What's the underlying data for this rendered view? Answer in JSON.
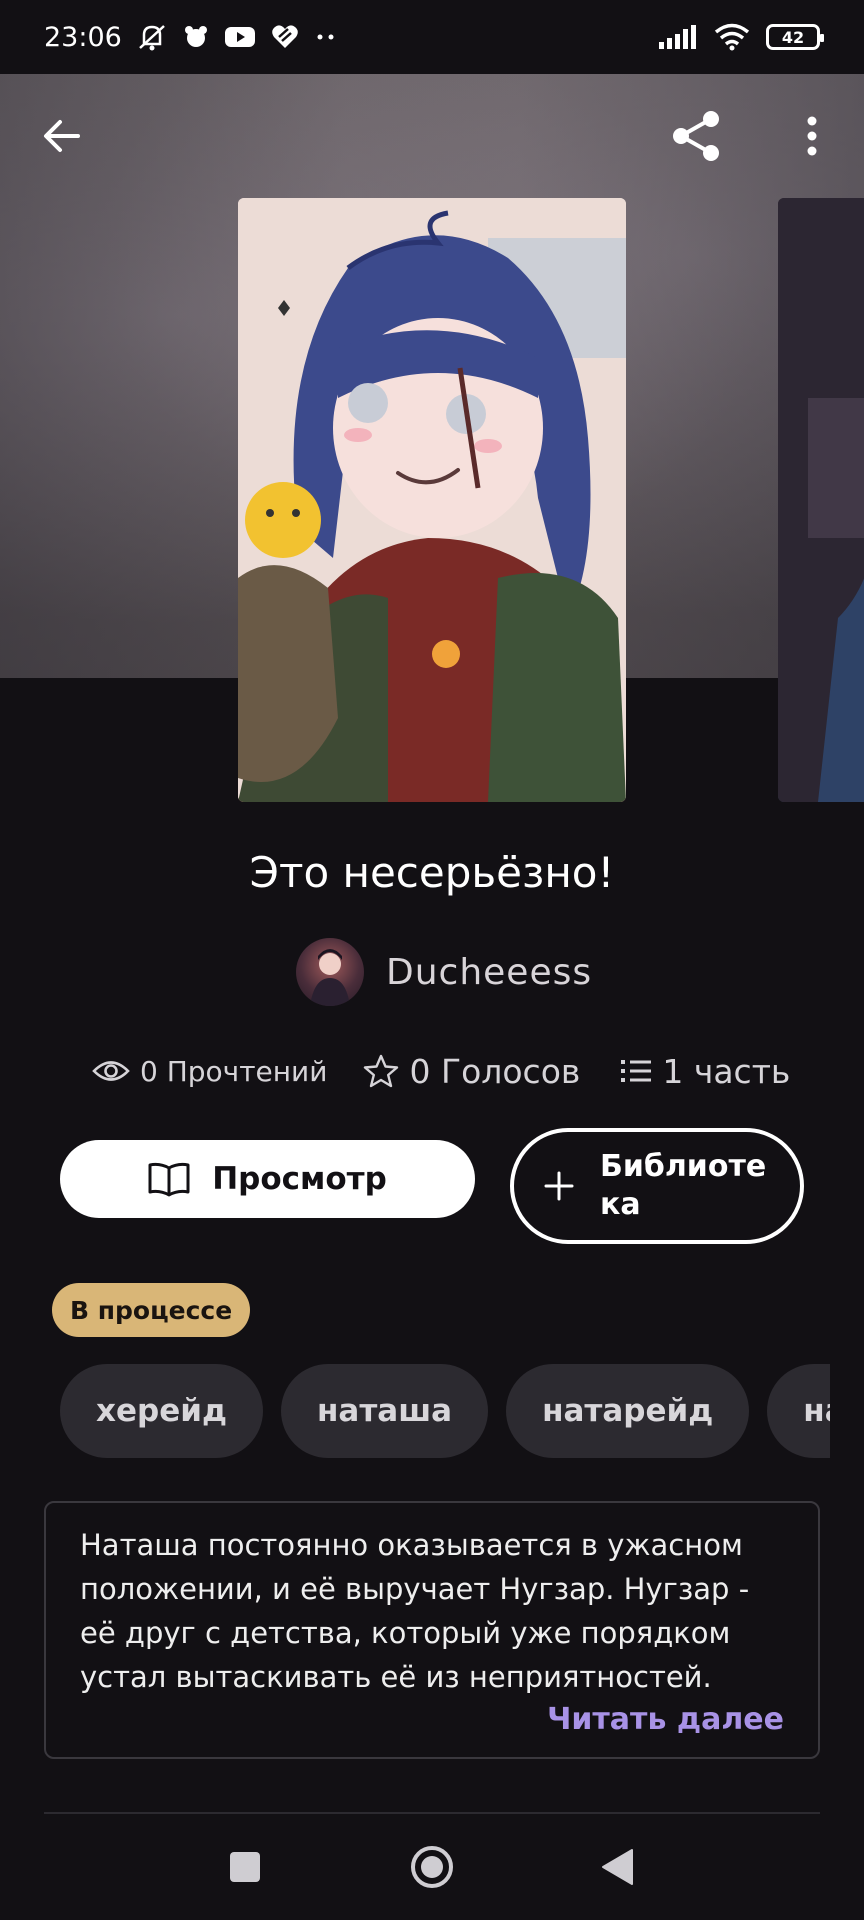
{
  "status_bar": {
    "time": "23:06",
    "battery": "42"
  },
  "story": {
    "title": "Это несерьёзно!",
    "author": "Ducheeess",
    "stats": {
      "reads": "0 Прочтений",
      "votes": "0 Голосов",
      "parts": "1 часть"
    },
    "status": "В процессе",
    "description": "Наташа постоянно оказывается в ужасном положении, и её выручает Нугзар. Нугзар - её друг с детства, который уже порядком устал вытаскивать её из неприятностей.",
    "read_more": "Читать далее"
  },
  "actions": {
    "view_label": "Просмотр",
    "library_label": "Библиотека"
  },
  "tags": [
    "херейд",
    "наташа",
    "натарейд",
    "нарко"
  ],
  "colors": {
    "background": "#121014",
    "badge": "#d9b677",
    "read_more": "#a892e6",
    "tag_bg": "#2c2a30"
  },
  "icons": {
    "back": "arrow-left-icon",
    "share": "share-icon",
    "more": "more-vertical-icon",
    "reads": "eye-icon",
    "votes": "star-icon",
    "parts": "list-icon",
    "view": "book-open-icon",
    "library": "plus-icon"
  }
}
